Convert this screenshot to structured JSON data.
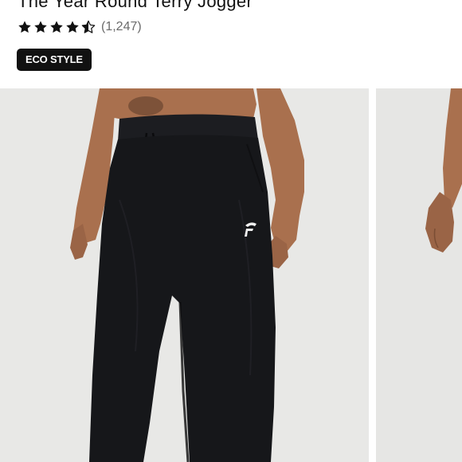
{
  "product": {
    "title": "The Year Round Terry Jogger",
    "rating": {
      "stars": 4.5,
      "max_stars": 5,
      "review_count_text": "(1,247)"
    },
    "badge": "ECO STYLE"
  },
  "gallery": {
    "images": [
      {
        "name": "model wearing black jogger, front view",
        "active": true
      },
      {
        "name": "model wearing black jogger, side view",
        "active": false
      }
    ]
  },
  "colors": {
    "text": "#111111",
    "muted": "#6b6b6b",
    "badge_bg": "#111111",
    "badge_text": "#ffffff",
    "photo_bg": "#e8e8e6",
    "garment": "#16171a",
    "skin": "#a9704e"
  }
}
